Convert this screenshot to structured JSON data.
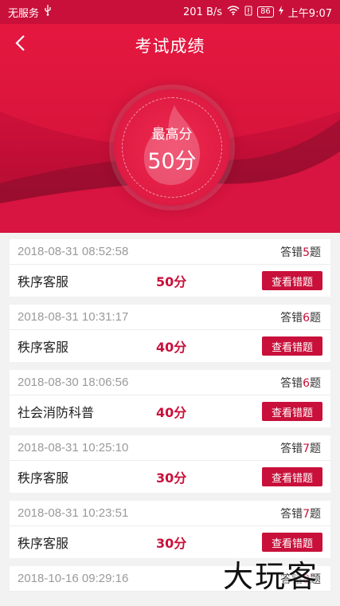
{
  "status_bar": {
    "carrier": "无服务",
    "usb_icon": "usb-icon",
    "speed": "201 B/s",
    "battery": "86",
    "time": "上午9:07"
  },
  "header": {
    "back_icon": "back-arrow-icon",
    "title": "考试成绩",
    "best_label": "最高分",
    "best_score": "50分"
  },
  "colors": {
    "primary": "#c8103a",
    "background": "#f2f2f2"
  },
  "records": [
    {
      "date": "2018-08-31 08:52:58",
      "wrong_prefix": "答错",
      "wrong_count": "5",
      "wrong_suffix": "题",
      "name": "秩序客服",
      "score": "50分",
      "button": "查看错题"
    },
    {
      "date": "2018-08-31 10:31:17",
      "wrong_prefix": "答错",
      "wrong_count": "6",
      "wrong_suffix": "题",
      "name": "秩序客服",
      "score": "40分",
      "button": "查看错题"
    },
    {
      "date": "2018-08-30 18:06:56",
      "wrong_prefix": "答错",
      "wrong_count": "6",
      "wrong_suffix": "题",
      "name": "社会消防科普",
      "score": "40分",
      "button": "查看错题"
    },
    {
      "date": "2018-08-31 10:25:10",
      "wrong_prefix": "答错",
      "wrong_count": "7",
      "wrong_suffix": "题",
      "name": "秩序客服",
      "score": "30分",
      "button": "查看错题"
    },
    {
      "date": "2018-08-31 10:23:51",
      "wrong_prefix": "答错",
      "wrong_count": "7",
      "wrong_suffix": "题",
      "name": "秩序客服",
      "score": "30分",
      "button": "查看错题"
    },
    {
      "date": "2018-10-16 09:29:16",
      "wrong_prefix": "答错",
      "wrong_count": "8",
      "wrong_suffix": "题",
      "name": "",
      "score": "",
      "button": ""
    }
  ],
  "watermark": "大玩客"
}
